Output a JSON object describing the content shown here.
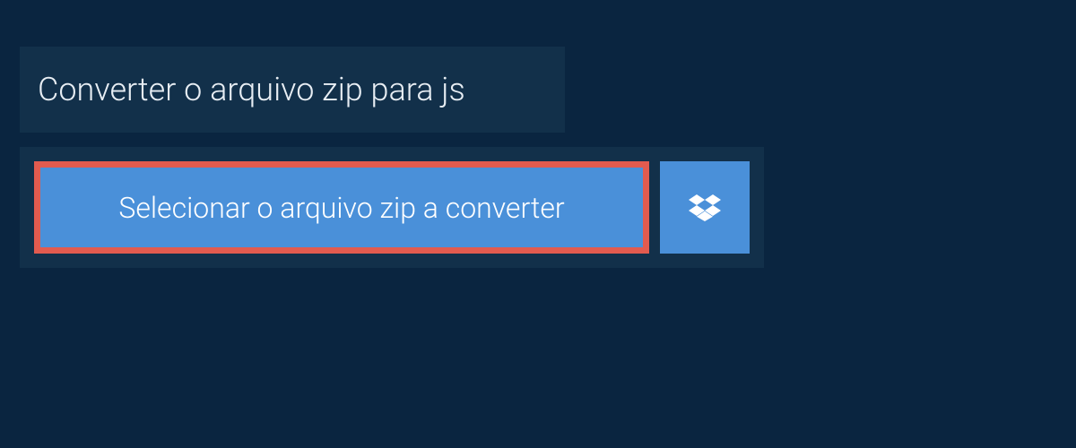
{
  "header": {
    "title": "Converter o arquivo zip para js"
  },
  "upload": {
    "select_button_label": "Selecionar o arquivo zip a converter"
  }
}
